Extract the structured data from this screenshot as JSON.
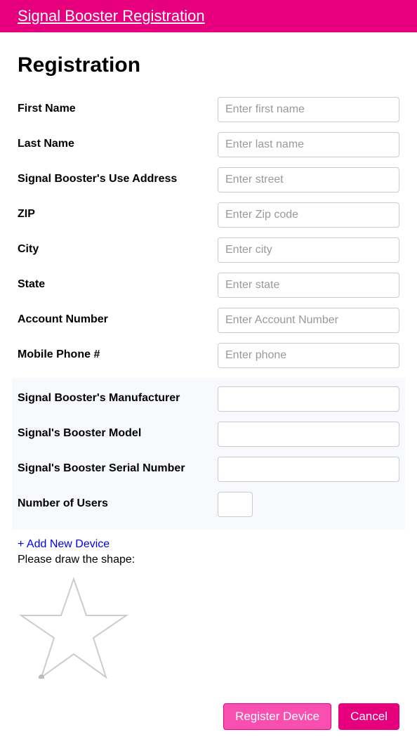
{
  "header": {
    "title": "Signal Booster Registration"
  },
  "page": {
    "heading": "Registration"
  },
  "fields": {
    "first_name": {
      "label": "First Name",
      "placeholder": "Enter first name",
      "value": ""
    },
    "last_name": {
      "label": "Last Name",
      "placeholder": "Enter last name",
      "value": ""
    },
    "use_address": {
      "label": "Signal Booster's Use Address",
      "placeholder": "Enter street",
      "value": ""
    },
    "zip": {
      "label": "ZIP",
      "placeholder": "Enter Zip code",
      "value": ""
    },
    "city": {
      "label": "City",
      "placeholder": "Enter city",
      "value": ""
    },
    "state": {
      "label": "State",
      "placeholder": "Enter state",
      "value": ""
    },
    "account_number": {
      "label": "Account Number",
      "placeholder": "Enter Account Number",
      "value": ""
    },
    "mobile_phone": {
      "label": "Mobile Phone #",
      "placeholder": "Enter phone",
      "value": ""
    },
    "manufacturer": {
      "label": "Signal Booster's Manufacturer",
      "placeholder": "",
      "value": ""
    },
    "model": {
      "label": "Signal's Booster Model",
      "placeholder": "",
      "value": ""
    },
    "serial": {
      "label": "Signal's Booster Serial Number",
      "placeholder": "",
      "value": ""
    },
    "num_users": {
      "label": "Number of Users",
      "placeholder": "",
      "value": ""
    }
  },
  "add_device": "+ Add New Device",
  "draw_label": "Please draw the shape:",
  "buttons": {
    "register": "Register Device",
    "cancel": "Cancel"
  }
}
